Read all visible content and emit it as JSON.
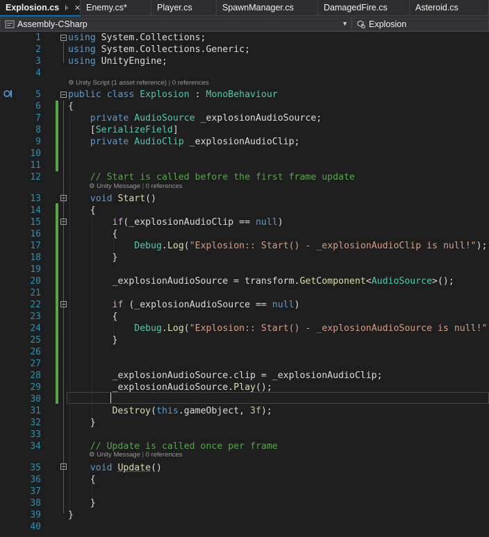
{
  "tabs": [
    {
      "label": "Explosion.cs",
      "active": true
    },
    {
      "label": "Enemy.cs*",
      "active": false
    },
    {
      "label": "Player.cs",
      "active": false
    },
    {
      "label": "SpawnManager.cs",
      "active": false
    },
    {
      "label": "DamagedFire.cs",
      "active": false
    },
    {
      "label": "Asteroid.cs",
      "active": false
    }
  ],
  "tab_pin": "⊧",
  "tab_close": "✕",
  "navbar": {
    "project": "Assembly-CSharp",
    "member": "Explosion"
  },
  "codelens": {
    "class_lens_a": "Unity Script (1 asset reference)",
    "class_lens_b": "0 references",
    "start_lens_a": "Unity Message",
    "start_lens_b": "0 references",
    "update_lens_a": "Unity Message",
    "update_lens_b": "0 references",
    "separator": "|"
  },
  "code_lines": [
    [
      [
        "kw",
        "using"
      ],
      [
        "pl",
        " System.Collections;"
      ]
    ],
    [
      [
        "kw",
        "using"
      ],
      [
        "pl",
        " System.Collections.Generic;"
      ]
    ],
    [
      [
        "kw",
        "using"
      ],
      [
        "pl",
        " UnityEngine;"
      ]
    ],
    [],
    [
      [
        "kw",
        "public class "
      ],
      [
        "ty",
        "Explosion"
      ],
      [
        "pl",
        " : "
      ],
      [
        "ty",
        "MonoBehaviour"
      ]
    ],
    [
      [
        "pl",
        "{"
      ]
    ],
    [
      [
        "pl",
        "    "
      ],
      [
        "kw",
        "private "
      ],
      [
        "ty",
        "AudioSource"
      ],
      [
        "pl",
        " _explosionAudioSource;"
      ]
    ],
    [
      [
        "pl",
        "    ["
      ],
      [
        "ty",
        "SerializeField"
      ],
      [
        "pl",
        "]"
      ]
    ],
    [
      [
        "pl",
        "    "
      ],
      [
        "kw",
        "private "
      ],
      [
        "ty",
        "AudioClip"
      ],
      [
        "pl",
        " _explosionAudioClip;"
      ]
    ],
    [],
    [],
    [
      [
        "pl",
        "    "
      ],
      [
        "cm",
        "// Start is called before the first frame update"
      ]
    ],
    [
      [
        "pl",
        "    "
      ],
      [
        "kw",
        "void "
      ],
      [
        "mt",
        "Start"
      ],
      [
        "pl",
        "()"
      ]
    ],
    [
      [
        "pl",
        "    {"
      ]
    ],
    [
      [
        "pl",
        "        "
      ],
      [
        "ct",
        "if"
      ],
      [
        "pl",
        "(_explosionAudioClip == "
      ],
      [
        "kw",
        "null"
      ],
      [
        "pl",
        ")"
      ]
    ],
    [
      [
        "pl",
        "        {"
      ]
    ],
    [
      [
        "pl",
        "            "
      ],
      [
        "ty",
        "Debug"
      ],
      [
        "pl",
        "."
      ],
      [
        "mt",
        "Log"
      ],
      [
        "pl",
        "("
      ],
      [
        "st",
        "\"Explosion:: Start() - _explosionAudioClip is null!\""
      ],
      [
        "pl",
        ");"
      ]
    ],
    [
      [
        "pl",
        "        }"
      ]
    ],
    [],
    [
      [
        "pl",
        "        _explosionAudioSource = transform."
      ],
      [
        "mt",
        "GetComponent"
      ],
      [
        "pl",
        "<"
      ],
      [
        "ty",
        "AudioSource"
      ],
      [
        "pl",
        ">();"
      ]
    ],
    [],
    [
      [
        "pl",
        "        "
      ],
      [
        "ct",
        "if"
      ],
      [
        "pl",
        " (_explosionAudioSource == "
      ],
      [
        "kw",
        "null"
      ],
      [
        "pl",
        ")"
      ]
    ],
    [
      [
        "pl",
        "        {"
      ]
    ],
    [
      [
        "pl",
        "            "
      ],
      [
        "ty",
        "Debug"
      ],
      [
        "pl",
        "."
      ],
      [
        "mt",
        "Log"
      ],
      [
        "pl",
        "("
      ],
      [
        "st",
        "\"Explosion:: Start() - _explosionAudioSource is null!\""
      ],
      [
        "pl",
        ");"
      ]
    ],
    [
      [
        "pl",
        "        }"
      ]
    ],
    [],
    [],
    [
      [
        "pl",
        "        _explosionAudioSource.clip = _explosionAudioClip;"
      ]
    ],
    [
      [
        "pl",
        "        _explosionAudioSource."
      ],
      [
        "mt",
        "Play"
      ],
      [
        "pl",
        "();"
      ]
    ],
    [],
    [
      [
        "pl",
        "        "
      ],
      [
        "mt",
        "Destroy"
      ],
      [
        "pl",
        "("
      ],
      [
        "kw",
        "this"
      ],
      [
        "pl",
        ".gameObject, "
      ],
      [
        "nm",
        "3f"
      ],
      [
        "pl",
        ");"
      ]
    ],
    [
      [
        "pl",
        "    }"
      ]
    ],
    [],
    [
      [
        "pl",
        "    "
      ],
      [
        "cm",
        "// Update is called once per frame"
      ]
    ],
    [
      [
        "pl",
        "    "
      ],
      [
        "kw",
        "void "
      ],
      [
        "mt",
        "Update"
      ],
      [
        "pl",
        "()"
      ]
    ],
    [
      [
        "pl",
        "    {"
      ]
    ],
    [],
    [
      [
        "pl",
        "    }"
      ]
    ],
    [
      [
        "pl",
        "}"
      ]
    ],
    []
  ],
  "colors": {
    "keyword": "#569cd6",
    "type": "#4ec9b0",
    "comment": "#57a64a",
    "string": "#d69d85",
    "method": "#dcdcaa",
    "number": "#b5cea8",
    "control": "#d8a0df",
    "line_number": "#2b91af",
    "change_bar": "#57a64a",
    "accent": "#007acc"
  }
}
